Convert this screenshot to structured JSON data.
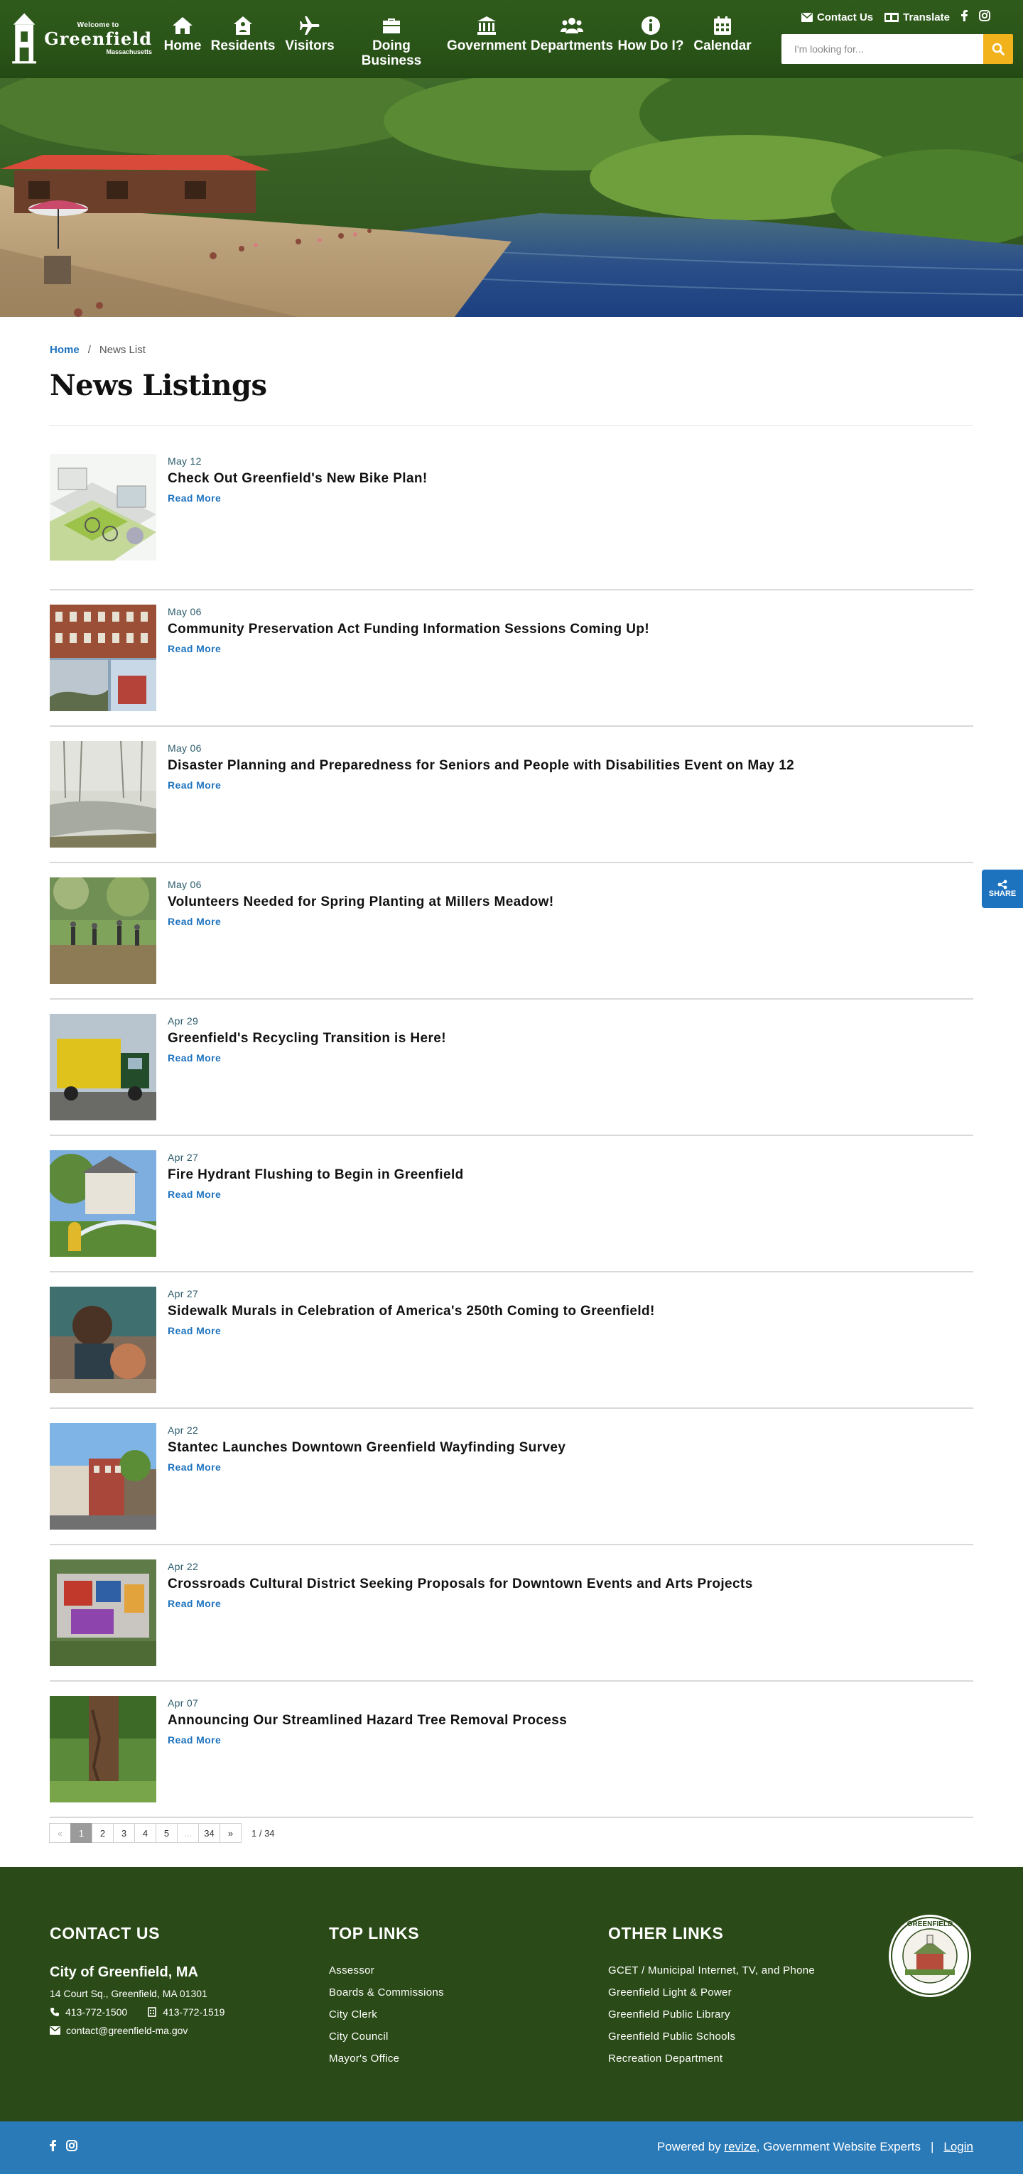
{
  "header": {
    "logo": {
      "welcome": "Welcome to",
      "city": "Greenfield",
      "state": "Massachusetts"
    },
    "nav": [
      {
        "label": "Home",
        "icon": "home-icon"
      },
      {
        "label": "Residents",
        "icon": "house-icon"
      },
      {
        "label": "Visitors",
        "icon": "plane-icon"
      },
      {
        "label": "Doing Business",
        "icon": "briefcase-icon"
      },
      {
        "label": "Government",
        "icon": "building-icon"
      },
      {
        "label": "Departments",
        "icon": "users-icon"
      },
      {
        "label": "How Do I?",
        "icon": "info-icon"
      },
      {
        "label": "Calendar",
        "icon": "calendar-icon"
      }
    ],
    "utility": {
      "contact": "Contact Us",
      "translate": "Translate"
    },
    "search": {
      "placeholder": "I'm looking for..."
    }
  },
  "breadcrumb": {
    "home": "Home",
    "separator": "/",
    "current": "News List"
  },
  "page_title": "News Listings",
  "news": [
    {
      "date": "May 12",
      "title": "Check Out Greenfield's New Bike Plan!",
      "more": "Read More"
    },
    {
      "date": "May 06",
      "title": "Community Preservation Act Funding Information Sessions Coming Up!",
      "more": "Read More"
    },
    {
      "date": "May 06",
      "title": "Disaster Planning and Preparedness for Seniors and People with Disabilities Event on May 12",
      "more": "Read More"
    },
    {
      "date": "May 06",
      "title": "Volunteers Needed for Spring Planting at Millers Meadow!",
      "more": "Read More"
    },
    {
      "date": "Apr 29",
      "title": "Greenfield's Recycling Transition is Here!",
      "more": "Read More"
    },
    {
      "date": "Apr 27",
      "title": "Fire Hydrant Flushing to Begin in Greenfield",
      "more": "Read More"
    },
    {
      "date": "Apr 27",
      "title": "Sidewalk Murals in Celebration of America's 250th Coming to Greenfield!",
      "more": "Read More"
    },
    {
      "date": "Apr 22",
      "title": "Stantec Launches Downtown Greenfield Wayfinding Survey",
      "more": "Read More"
    },
    {
      "date": "Apr 22",
      "title": "Crossroads Cultural District Seeking Proposals for Downtown Events and Arts Projects",
      "more": "Read More"
    },
    {
      "date": "Apr 07",
      "title": "Announcing Our Streamlined Hazard Tree Removal Process",
      "more": "Read More"
    }
  ],
  "pagination": {
    "prev": "«",
    "pages": [
      "1",
      "2",
      "3",
      "4",
      "5",
      "...",
      "34"
    ],
    "next": "»",
    "count": "1 / 34",
    "current": "1"
  },
  "share": {
    "label": "SHARE"
  },
  "footer": {
    "contact": {
      "heading": "CONTACT US",
      "city": "City of Greenfield, MA",
      "address": "14 Court Sq., Greenfield, MA 01301",
      "phone": "413-772-1500",
      "fax": "413-772-1519",
      "email": "contact@greenfield-ma.gov"
    },
    "top_links": {
      "heading": "TOP LINKS",
      "items": [
        "Assessor",
        "Boards & Commissions",
        "City Clerk",
        "City Council",
        "Mayor's Office"
      ]
    },
    "other_links": {
      "heading": "OTHER LINKS",
      "items": [
        "GCET / Municipal Internet, TV, and Phone",
        "Greenfield Light & Power",
        "Greenfield Public Library",
        "Greenfield Public Schools",
        "Recreation Department"
      ]
    },
    "seal_text": "GREENFIELD"
  },
  "bottom_bar": {
    "powered": "Powered by",
    "brand": "revize",
    "tagline": "Government Website Experts",
    "divider": "|",
    "login": "Login"
  },
  "colors": {
    "header_green": "#2f5b1c",
    "footer_green": "#2a4a17",
    "accent_blue": "#1e73be",
    "search_yellow": "#f2b21c",
    "bottom_bar_blue": "#2a7ab8"
  }
}
